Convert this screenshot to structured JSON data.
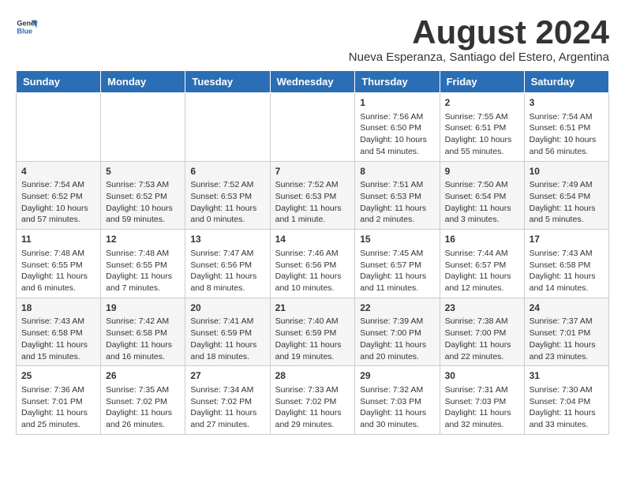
{
  "header": {
    "logo_general": "General",
    "logo_blue": "Blue",
    "month_title": "August 2024",
    "subtitle": "Nueva Esperanza, Santiago del Estero, Argentina"
  },
  "calendar": {
    "weekdays": [
      "Sunday",
      "Monday",
      "Tuesday",
      "Wednesday",
      "Thursday",
      "Friday",
      "Saturday"
    ],
    "weeks": [
      [
        {
          "day": "",
          "content": ""
        },
        {
          "day": "",
          "content": ""
        },
        {
          "day": "",
          "content": ""
        },
        {
          "day": "",
          "content": ""
        },
        {
          "day": "1",
          "content": "Sunrise: 7:56 AM\nSunset: 6:50 PM\nDaylight: 10 hours\nand 54 minutes."
        },
        {
          "day": "2",
          "content": "Sunrise: 7:55 AM\nSunset: 6:51 PM\nDaylight: 10 hours\nand 55 minutes."
        },
        {
          "day": "3",
          "content": "Sunrise: 7:54 AM\nSunset: 6:51 PM\nDaylight: 10 hours\nand 56 minutes."
        }
      ],
      [
        {
          "day": "4",
          "content": "Sunrise: 7:54 AM\nSunset: 6:52 PM\nDaylight: 10 hours\nand 57 minutes."
        },
        {
          "day": "5",
          "content": "Sunrise: 7:53 AM\nSunset: 6:52 PM\nDaylight: 10 hours\nand 59 minutes."
        },
        {
          "day": "6",
          "content": "Sunrise: 7:52 AM\nSunset: 6:53 PM\nDaylight: 11 hours\nand 0 minutes."
        },
        {
          "day": "7",
          "content": "Sunrise: 7:52 AM\nSunset: 6:53 PM\nDaylight: 11 hours\nand 1 minute."
        },
        {
          "day": "8",
          "content": "Sunrise: 7:51 AM\nSunset: 6:53 PM\nDaylight: 11 hours\nand 2 minutes."
        },
        {
          "day": "9",
          "content": "Sunrise: 7:50 AM\nSunset: 6:54 PM\nDaylight: 11 hours\nand 3 minutes."
        },
        {
          "day": "10",
          "content": "Sunrise: 7:49 AM\nSunset: 6:54 PM\nDaylight: 11 hours\nand 5 minutes."
        }
      ],
      [
        {
          "day": "11",
          "content": "Sunrise: 7:48 AM\nSunset: 6:55 PM\nDaylight: 11 hours\nand 6 minutes."
        },
        {
          "day": "12",
          "content": "Sunrise: 7:48 AM\nSunset: 6:55 PM\nDaylight: 11 hours\nand 7 minutes."
        },
        {
          "day": "13",
          "content": "Sunrise: 7:47 AM\nSunset: 6:56 PM\nDaylight: 11 hours\nand 8 minutes."
        },
        {
          "day": "14",
          "content": "Sunrise: 7:46 AM\nSunset: 6:56 PM\nDaylight: 11 hours\nand 10 minutes."
        },
        {
          "day": "15",
          "content": "Sunrise: 7:45 AM\nSunset: 6:57 PM\nDaylight: 11 hours\nand 11 minutes."
        },
        {
          "day": "16",
          "content": "Sunrise: 7:44 AM\nSunset: 6:57 PM\nDaylight: 11 hours\nand 12 minutes."
        },
        {
          "day": "17",
          "content": "Sunrise: 7:43 AM\nSunset: 6:58 PM\nDaylight: 11 hours\nand 14 minutes."
        }
      ],
      [
        {
          "day": "18",
          "content": "Sunrise: 7:43 AM\nSunset: 6:58 PM\nDaylight: 11 hours\nand 15 minutes."
        },
        {
          "day": "19",
          "content": "Sunrise: 7:42 AM\nSunset: 6:58 PM\nDaylight: 11 hours\nand 16 minutes."
        },
        {
          "day": "20",
          "content": "Sunrise: 7:41 AM\nSunset: 6:59 PM\nDaylight: 11 hours\nand 18 minutes."
        },
        {
          "day": "21",
          "content": "Sunrise: 7:40 AM\nSunset: 6:59 PM\nDaylight: 11 hours\nand 19 minutes."
        },
        {
          "day": "22",
          "content": "Sunrise: 7:39 AM\nSunset: 7:00 PM\nDaylight: 11 hours\nand 20 minutes."
        },
        {
          "day": "23",
          "content": "Sunrise: 7:38 AM\nSunset: 7:00 PM\nDaylight: 11 hours\nand 22 minutes."
        },
        {
          "day": "24",
          "content": "Sunrise: 7:37 AM\nSunset: 7:01 PM\nDaylight: 11 hours\nand 23 minutes."
        }
      ],
      [
        {
          "day": "25",
          "content": "Sunrise: 7:36 AM\nSunset: 7:01 PM\nDaylight: 11 hours\nand 25 minutes."
        },
        {
          "day": "26",
          "content": "Sunrise: 7:35 AM\nSunset: 7:02 PM\nDaylight: 11 hours\nand 26 minutes."
        },
        {
          "day": "27",
          "content": "Sunrise: 7:34 AM\nSunset: 7:02 PM\nDaylight: 11 hours\nand 27 minutes."
        },
        {
          "day": "28",
          "content": "Sunrise: 7:33 AM\nSunset: 7:02 PM\nDaylight: 11 hours\nand 29 minutes."
        },
        {
          "day": "29",
          "content": "Sunrise: 7:32 AM\nSunset: 7:03 PM\nDaylight: 11 hours\nand 30 minutes."
        },
        {
          "day": "30",
          "content": "Sunrise: 7:31 AM\nSunset: 7:03 PM\nDaylight: 11 hours\nand 32 minutes."
        },
        {
          "day": "31",
          "content": "Sunrise: 7:30 AM\nSunset: 7:04 PM\nDaylight: 11 hours\nand 33 minutes."
        }
      ]
    ]
  }
}
